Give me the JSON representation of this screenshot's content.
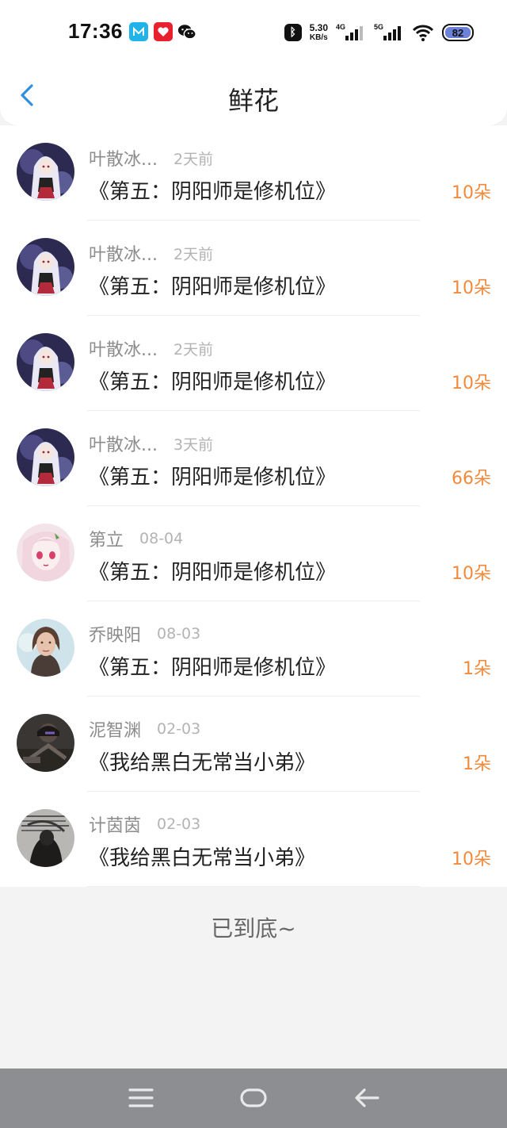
{
  "status_bar": {
    "time": "17:36",
    "apps": [
      "app-icon-blue",
      "app-icon-red",
      "wechat-icon"
    ],
    "speed_value": "5.30",
    "speed_unit": "KB/s",
    "sim1": "4G",
    "sim2": "5G",
    "battery": "82"
  },
  "header": {
    "title": "鲜花"
  },
  "items": [
    {
      "name": "叶散冰...",
      "time": "2天前",
      "book": "《第五：阴阳师是修机位》",
      "count": "10朵",
      "avatar": "anime-girl-white-hair"
    },
    {
      "name": "叶散冰...",
      "time": "2天前",
      "book": "《第五：阴阳师是修机位》",
      "count": "10朵",
      "avatar": "anime-girl-white-hair"
    },
    {
      "name": "叶散冰...",
      "time": "2天前",
      "book": "《第五：阴阳师是修机位》",
      "count": "10朵",
      "avatar": "anime-girl-white-hair"
    },
    {
      "name": "叶散冰...",
      "time": "3天前",
      "book": "《第五：阴阳师是修机位》",
      "count": "66朵",
      "avatar": "anime-girl-white-hair"
    },
    {
      "name": "第立",
      "time": "08-04",
      "book": "《第五：阴阳师是修机位》",
      "count": "10朵",
      "avatar": "anime-girl-pink"
    },
    {
      "name": "乔映阳",
      "time": "08-03",
      "book": "《第五：阴阳师是修机位》",
      "count": "1朵",
      "avatar": "woman-photo"
    },
    {
      "name": "泥智渊",
      "time": "02-03",
      "book": "《我给黑白无常当小弟》",
      "count": "1朵",
      "avatar": "dark-photo"
    },
    {
      "name": "计茵茵",
      "time": "02-03",
      "book": "《我给黑白无常当小弟》",
      "count": "10朵",
      "avatar": "grim-reaper-text"
    }
  ],
  "footer": {
    "end_text": "已到底~"
  },
  "colors": {
    "accent_orange": "#f08a3c",
    "back_blue": "#2f8fe0"
  }
}
